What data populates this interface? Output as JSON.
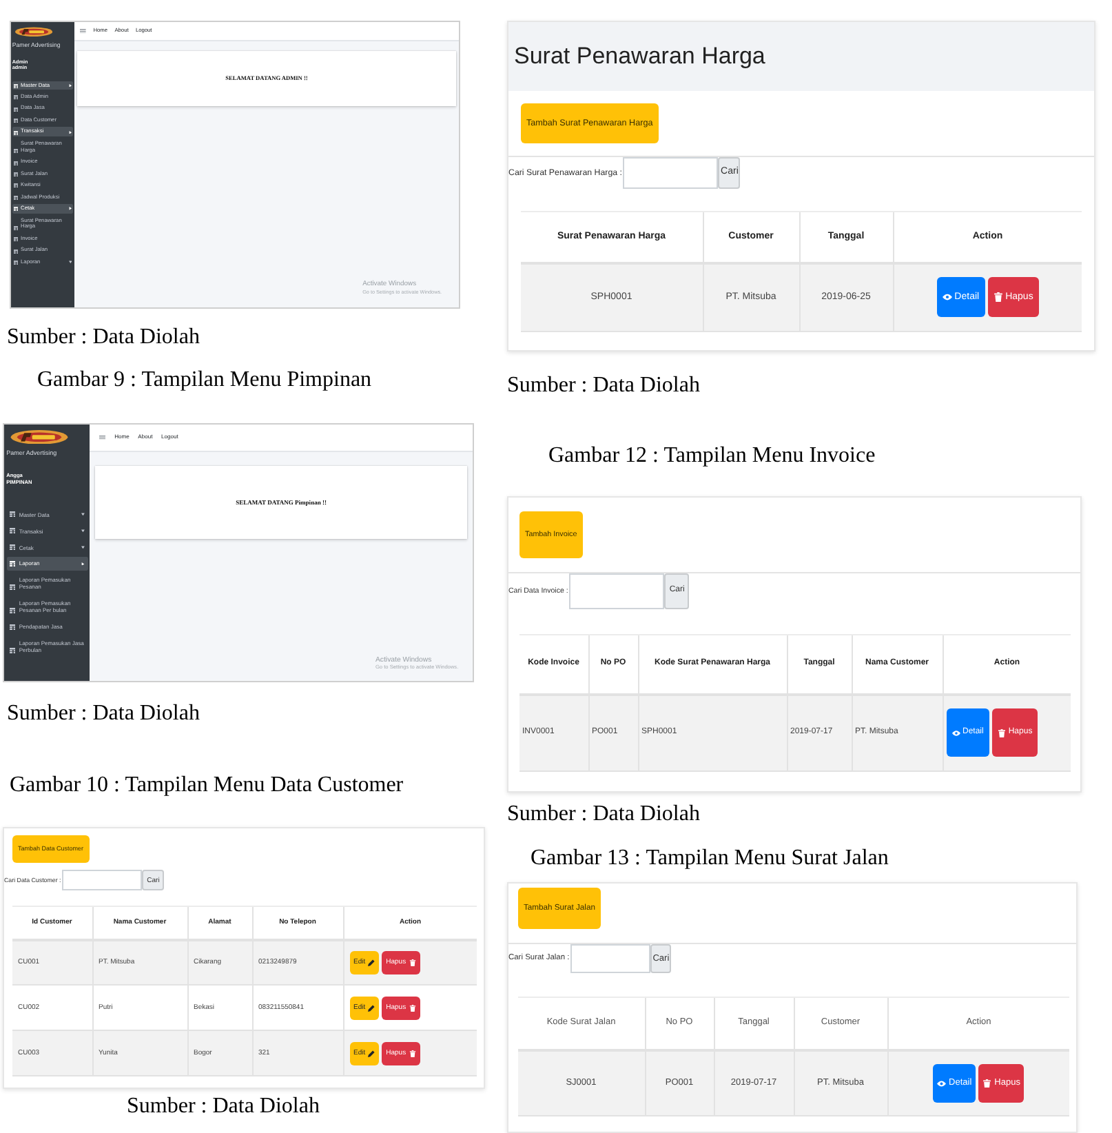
{
  "left_column": [
    {
      "kind": "dashboard",
      "brand": "Pamer Advertising",
      "user_name": "Admin",
      "user_role": "admin",
      "nav": [
        "Home",
        "About",
        "Logout"
      ],
      "welcome": "SELAMAT DATANG ADMIN !!",
      "menu": [
        {
          "label": "Master Data",
          "expanded": true,
          "children": [
            {
              "label": "Data Admin"
            },
            {
              "label": "Data Jasa"
            },
            {
              "label": "Data Customer"
            }
          ]
        },
        {
          "label": "Transaksi",
          "expanded": true,
          "children": [
            {
              "label": "Surat Penawaran Harga"
            },
            {
              "label": "Invoice"
            },
            {
              "label": "Surat Jalan"
            },
            {
              "label": "Kwitansi"
            },
            {
              "label": "Jadwal Produksi"
            }
          ]
        },
        {
          "label": "Cetak",
          "expanded": true,
          "children": [
            {
              "label": "Surat Penawaran Harga"
            },
            {
              "label": "Invoice"
            },
            {
              "label": "Surat Jalan"
            }
          ]
        },
        {
          "label": "Laporan",
          "expanded": false
        }
      ],
      "notice": [
        "Activate Windows",
        "Go to Settings to activate Windows."
      ]
    },
    {
      "kind": "source",
      "text": "Sumber : Data Diolah"
    },
    {
      "kind": "caption",
      "text": "Gambar 9 : Tampilan Menu Pimpinan"
    },
    {
      "kind": "dashboard",
      "brand": "Pamer Advertising",
      "user_name": "Angga",
      "user_role": "PIMPINAN",
      "nav": [
        "Home",
        "About",
        "Logout"
      ],
      "welcome": "SELAMAT DATANG Pimpinan !!",
      "menu": [
        {
          "label": "Master Data",
          "expanded": false
        },
        {
          "label": "Transaksi",
          "expanded": false
        },
        {
          "label": "Cetak",
          "expanded": false
        },
        {
          "label": "Laporan",
          "expanded": true,
          "children": [
            {
              "label": "Laporan Pemasukan Pesanan"
            },
            {
              "label": "Laporan Pemasukan Pesanan Per bulan"
            },
            {
              "label": "Pendapatan Jasa"
            },
            {
              "label": "Laporan Pemasukan Jasa Perbulan"
            }
          ]
        }
      ],
      "notice": [
        "Activate Windows",
        "Go to Settings to activate Windows."
      ]
    },
    {
      "kind": "source",
      "text": "Sumber : Data Diolah"
    },
    {
      "kind": "caption",
      "text": "Gambar 10 : Tampilan Menu Data Customer"
    },
    {
      "kind": "table_page",
      "add_button": "Tambah Data Customer",
      "search_label": "Cari Data Customer :",
      "search_button": "Cari",
      "header_bold": true,
      "icon_after": true,
      "columns": [
        "Id Customer",
        "Nama Customer",
        "Alamat",
        "No Telepon",
        "Action"
      ],
      "rows": [
        {
          "cells": [
            "CU001",
            "PT. Mitsuba",
            "Cikarang",
            "0213249879"
          ],
          "actions": [
            {
              "kind": "edit",
              "label": "Edit"
            },
            {
              "kind": "delete",
              "label": "Hapus"
            }
          ]
        },
        {
          "cells": [
            "CU002",
            "Putri",
            "Bekasi",
            "083211550841"
          ],
          "actions": [
            {
              "kind": "edit",
              "label": "Edit"
            },
            {
              "kind": "delete",
              "label": "Hapus"
            }
          ]
        },
        {
          "cells": [
            "CU003",
            "Yunita",
            "Bogor",
            "321"
          ],
          "actions": [
            {
              "kind": "edit",
              "label": "Edit"
            },
            {
              "kind": "delete",
              "label": "Hapus"
            }
          ]
        }
      ]
    },
    {
      "kind": "source",
      "text": "Sumber : Data Diolah"
    }
  ],
  "right_column": [
    {
      "kind": "table_page",
      "title": "Surat Penawaran Harga",
      "add_button": "Tambah Surat Penawaran Harga",
      "search_label": "Cari Surat Penawaran Harga :",
      "search_button": "Cari",
      "header_bold": true,
      "icon_after": false,
      "columns": [
        "Surat Penawaran Harga",
        "Customer",
        "Tanggal",
        "Action"
      ],
      "rows": [
        {
          "cells": [
            "SPH0001",
            "PT. Mitsuba",
            "2019-06-25"
          ],
          "actions": [
            {
              "kind": "detail",
              "label": "Detail"
            },
            {
              "kind": "delete",
              "label": "Hapus"
            }
          ]
        }
      ]
    },
    {
      "kind": "source",
      "text": "Sumber : Data Diolah"
    },
    {
      "kind": "caption",
      "text": "Gambar 12 : Tampilan Menu Invoice"
    },
    {
      "kind": "table_page",
      "add_button": "Tambah Invoice",
      "search_label": "Cari Data Invoice :",
      "search_button": "Cari",
      "header_bold": true,
      "icon_after": false,
      "columns": [
        "Kode Invoice",
        "No PO",
        "Kode Surat Penawaran Harga",
        "Tanggal",
        "Nama Customer",
        "Action"
      ],
      "rows": [
        {
          "cells": [
            "INV0001",
            "PO001",
            "SPH0001",
            "2019-07-17",
            "PT. Mitsuba"
          ],
          "actions": [
            {
              "kind": "detail",
              "label": "Detail"
            },
            {
              "kind": "delete",
              "label": "Hapus"
            }
          ]
        }
      ]
    },
    {
      "kind": "source",
      "text": "Sumber : Data Diolah"
    },
    {
      "kind": "caption",
      "text": "Gambar 13 : Tampilan Menu Surat Jalan"
    },
    {
      "kind": "table_page",
      "add_button": "Tambah Surat Jalan",
      "search_label": "Cari Surat Jalan :",
      "search_button": "Cari",
      "header_bold": false,
      "icon_after": false,
      "columns": [
        "Kode Surat Jalan",
        "No PO",
        "Tanggal",
        "Customer",
        "Action"
      ],
      "rows": [
        {
          "cells": [
            "SJ0001",
            "PO001",
            "2019-07-17",
            "PT. Mitsuba"
          ],
          "actions": [
            {
              "kind": "detail",
              "label": "Detail"
            },
            {
              "kind": "delete",
              "label": "Hapus"
            }
          ]
        }
      ]
    }
  ]
}
